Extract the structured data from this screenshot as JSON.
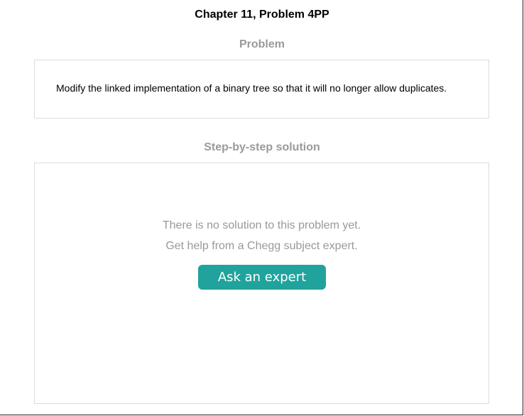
{
  "page": {
    "title": "Chapter 11, Problem 4PP"
  },
  "problem": {
    "heading": "Problem",
    "text": "Modify the linked implementation of a binary tree so that it will no longer allow duplicates."
  },
  "solution": {
    "heading": "Step-by-step solution",
    "empty_message": "There is no solution to this problem yet.",
    "help_message": "Get help from a Chegg subject expert.",
    "button_label": "Ask an expert"
  },
  "colors": {
    "heading_gray": "#9a9a9a",
    "message_gray": "#999999",
    "box_border": "#dcdcdc",
    "accent_teal": "#20a39c"
  }
}
